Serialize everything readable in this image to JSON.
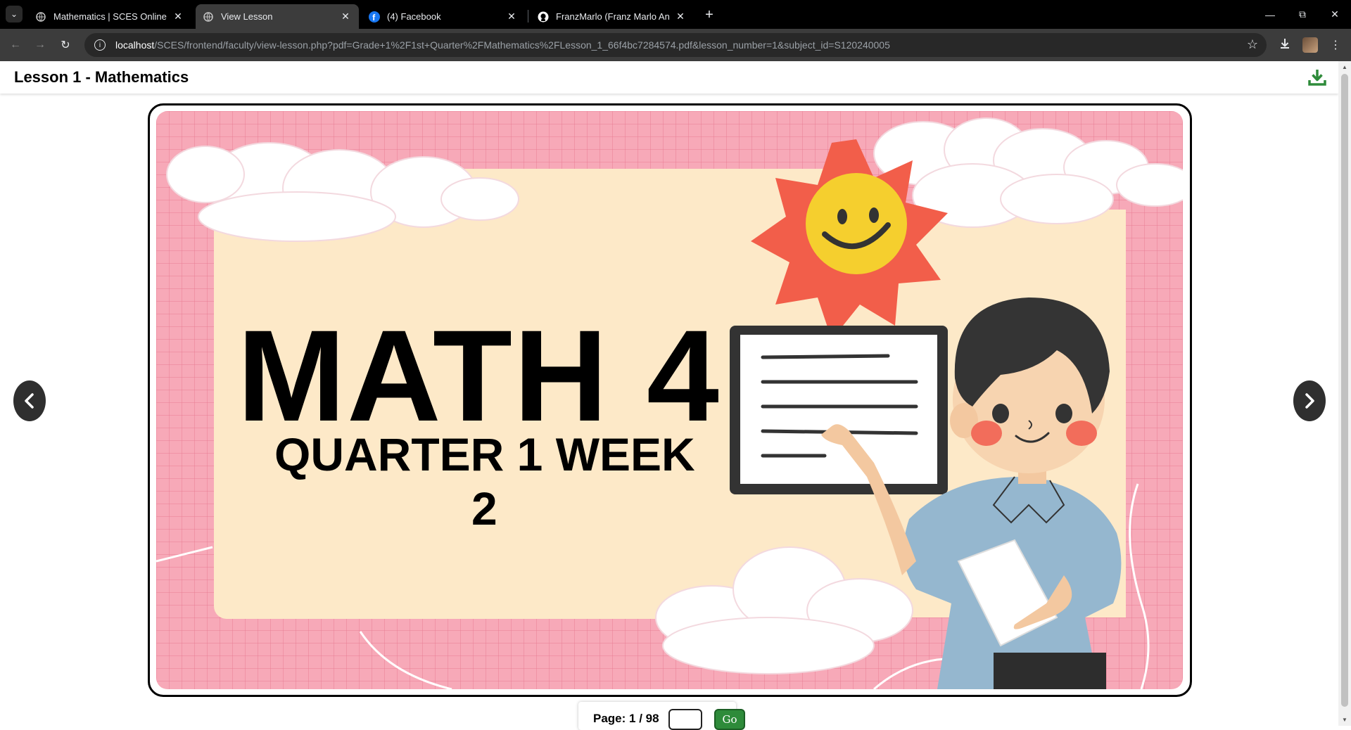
{
  "browser": {
    "tabs": [
      {
        "title": "Mathematics | SCES Online Lea",
        "active": false,
        "icon": "globe-icon"
      },
      {
        "title": "View Lesson",
        "active": true,
        "icon": "globe-icon"
      },
      {
        "title": "(4) Facebook",
        "active": false,
        "icon": "facebook-icon"
      },
      {
        "title": "FranzMarlo (Franz Marlo Andal)",
        "active": false,
        "icon": "github-icon"
      }
    ],
    "url_host": "localhost",
    "url_path": "/SCES/frontend/faculty/view-lesson.php?pdf=Grade+1%2F1st+Quarter%2FMathematics%2FLesson_1_66f4bc7284574.pdf&lesson_number=1&subject_id=S120240005"
  },
  "page": {
    "title": "Lesson 1 - Mathematics"
  },
  "slide": {
    "title": "MATH 4",
    "subtitle_line1": "QUARTER 1 WEEK",
    "subtitle_line2": "2"
  },
  "pager": {
    "label": "Page: 1 / 98",
    "input_value": "",
    "go_label": "Go"
  },
  "colors": {
    "accent_green": "#2e8b3a",
    "slide_pink": "#f7a9b8",
    "slide_cream": "#fde9c8"
  }
}
